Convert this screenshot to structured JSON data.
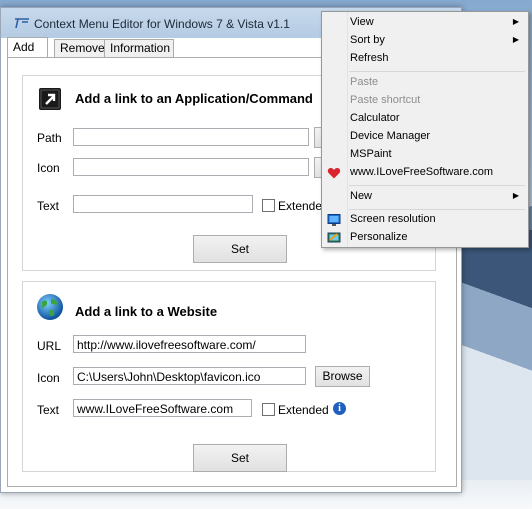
{
  "window": {
    "title": "Context Menu Editor for Windows 7 & Vista v1.1"
  },
  "tabs": [
    {
      "label": "Add",
      "active": true
    },
    {
      "label": "Remove",
      "active": false
    },
    {
      "label": "Information",
      "active": false
    }
  ],
  "app_section": {
    "title": "Add a link to an Application/Command",
    "path_label": "Path",
    "path_value": "",
    "icon_label": "Icon",
    "icon_value": "",
    "text_label": "Text",
    "text_value": "",
    "extended_label": "Extended",
    "extended_checked": false,
    "set_label": "Set"
  },
  "web_section": {
    "title": "Add a link to a Website",
    "url_label": "URL",
    "url_value": "http://www.ilovefreesoftware.com/",
    "icon_label": "Icon",
    "icon_value": "C:\\Users\\John\\Desktop\\favicon.ico",
    "browse_label": "Browse",
    "text_label": "Text",
    "text_value": "www.ILoveFreeSoftware.com",
    "extended_label": "Extended",
    "extended_checked": false,
    "info_glyph": "i",
    "set_label": "Set"
  },
  "context_menu": {
    "items": [
      {
        "label": "View",
        "submenu": true,
        "enabled": true,
        "icon": ""
      },
      {
        "label": "Sort by",
        "submenu": true,
        "enabled": true,
        "icon": ""
      },
      {
        "label": "Refresh",
        "submenu": false,
        "enabled": true,
        "icon": ""
      },
      {
        "label": "Paste",
        "submenu": false,
        "enabled": false,
        "icon": ""
      },
      {
        "label": "Paste shortcut",
        "submenu": false,
        "enabled": false,
        "icon": ""
      },
      {
        "label": "Calculator",
        "submenu": false,
        "enabled": true,
        "icon": ""
      },
      {
        "label": "Device Manager",
        "submenu": false,
        "enabled": true,
        "icon": ""
      },
      {
        "label": "MSPaint",
        "submenu": false,
        "enabled": true,
        "icon": ""
      },
      {
        "label": "www.ILoveFreeSoftware.com",
        "submenu": false,
        "enabled": true,
        "icon": "heart-icon"
      },
      {
        "label": "New",
        "submenu": true,
        "enabled": true,
        "icon": ""
      },
      {
        "label": "Screen resolution",
        "submenu": false,
        "enabled": true,
        "icon": "monitor-icon"
      },
      {
        "label": "Personalize",
        "submenu": false,
        "enabled": true,
        "icon": "personalize-icon"
      }
    ]
  },
  "colors": {
    "heart": "#d9232d",
    "info": "#1f5fbf",
    "titlebar": "#c0d4ea"
  }
}
